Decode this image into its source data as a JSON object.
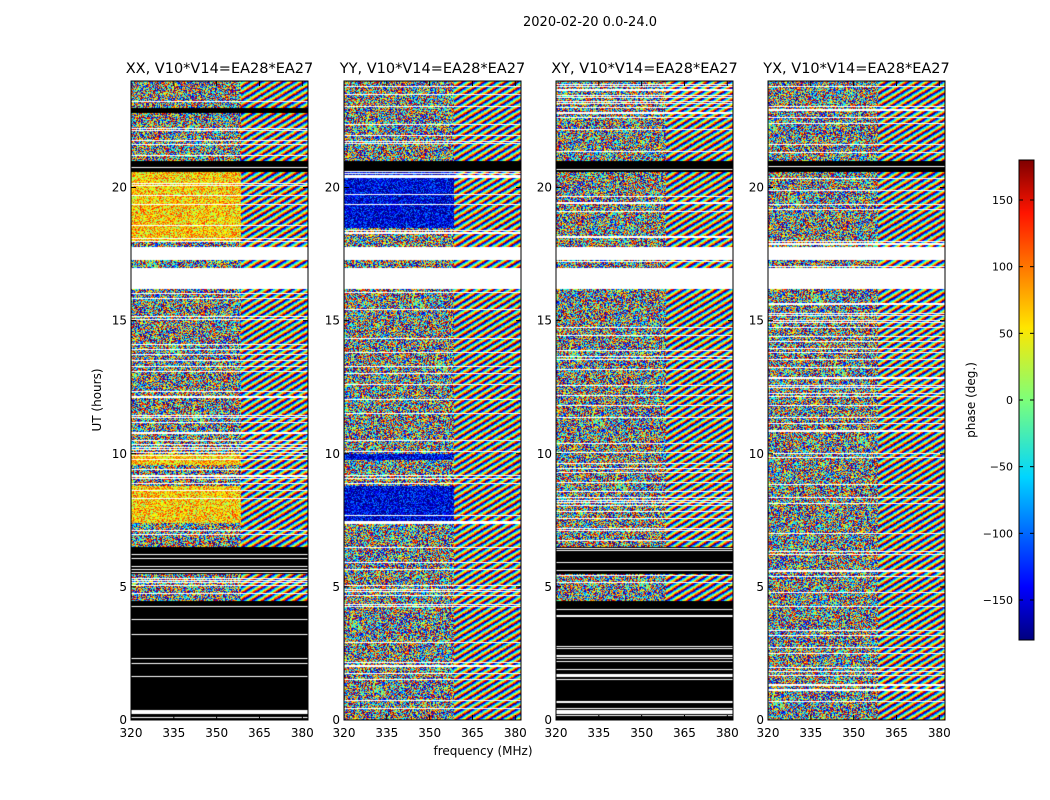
{
  "figure": {
    "suptitle": "2020-02-20 0.0-24.0"
  },
  "chart_data": {
    "type": "heatmap",
    "shared_xlabel": "frequency (MHz)",
    "shared_ylabel": "UT (hours)",
    "xlim": [
      320,
      382
    ],
    "ylim": [
      0,
      24
    ],
    "xticks": [
      320,
      335,
      350,
      365,
      380
    ],
    "yticks": [
      0,
      5,
      10,
      15,
      20
    ],
    "colorbar": {
      "label": "phase (deg.)",
      "range": [
        -180,
        180
      ],
      "ticks": [
        150,
        100,
        50,
        0,
        -50,
        -100,
        -150
      ],
      "tick_labels": [
        "150",
        "100",
        "50",
        "0",
        "−50",
        "−100",
        "−150"
      ],
      "colormap": "jet"
    },
    "panels": [
      {
        "title": "XX, V10*V14=EA28*EA27",
        "blank_ranges": [
          [
            16.2,
            17.0
          ],
          [
            17.3,
            17.8
          ],
          [
            0.25,
            0.4
          ]
        ],
        "black_ranges": [
          [
            0.0,
            0.25
          ],
          [
            0.4,
            4.5
          ],
          [
            5.5,
            6.5
          ],
          [
            20.6,
            21.0
          ],
          [
            22.8,
            23.0
          ]
        ],
        "coherent_low_freq_ranges": [
          [
            18.0,
            20.6
          ],
          [
            7.4,
            8.8
          ],
          [
            9.6,
            10.0
          ]
        ],
        "coherent_low_freq_hue": 60
      },
      {
        "title": "YY, V10*V14=EA28*EA27",
        "blank_ranges": [
          [
            16.2,
            17.0
          ],
          [
            17.3,
            17.8
          ]
        ],
        "black_ranges": [
          [
            20.6,
            21.0
          ]
        ],
        "coherent_low_freq_ranges": [
          [
            18.5,
            20.6
          ],
          [
            7.4,
            8.8
          ],
          [
            9.8,
            10.0
          ]
        ],
        "coherent_low_freq_hue": -145
      },
      {
        "title": "XY, V10*V14=EA28*EA27",
        "blank_ranges": [
          [
            16.2,
            17.0
          ],
          [
            17.3,
            17.8
          ],
          [
            0.25,
            0.4
          ]
        ],
        "black_ranges": [
          [
            0.0,
            0.25
          ],
          [
            0.4,
            4.5
          ],
          [
            5.5,
            6.5
          ],
          [
            20.6,
            21.0
          ]
        ],
        "coherent_low_freq_ranges": [],
        "coherent_low_freq_hue": 0
      },
      {
        "title": "YX, V10*V14=EA28*EA27",
        "blank_ranges": [
          [
            16.2,
            17.0
          ],
          [
            17.3,
            17.8
          ]
        ],
        "black_ranges": [
          [
            20.6,
            21.0
          ]
        ],
        "coherent_low_freq_ranges": [],
        "coherent_low_freq_hue": 0
      }
    ]
  }
}
